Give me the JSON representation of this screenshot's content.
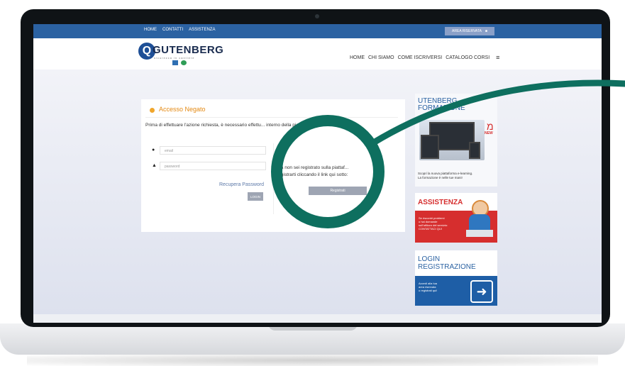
{
  "topbar": {
    "links": [
      "HOME",
      "CONTATTI",
      "ASSISTENZA"
    ],
    "area_riservata": "AREA RISERVATA"
  },
  "logo": {
    "mark": "Q",
    "name": "GUTENBERG",
    "tagline": "sicurezza in cantiere"
  },
  "main_nav": [
    "HOME",
    "CHI SIAMO",
    "COME ISCRIVERSI",
    "CATALOGO CORSI"
  ],
  "panel": {
    "title": "Accesso Negato",
    "message": "Prima di effettuare l'azione richiesta, è necessario effettu...                        interno della piatt...",
    "email_placeholder": "email",
    "password_placeholder": "password",
    "recupera": "Recupera Password",
    "login_label": "LOGIN",
    "reg_line1": "ora non sei registrato sulla piattaf...",
    "reg_line2": "registrarti cliccando il link qui sotto:",
    "registrati_label": "Registrati"
  },
  "ads": {
    "formazione": {
      "title_line1": "UTENBERG",
      "title_line2": "FORMAZIONE",
      "new": "NEW",
      "text_line1": "Scopri la nuova piattaforma e-learning.",
      "text_line2": "La formazione è nelle tue mani!"
    },
    "assistenza": {
      "title": "ASSISTENZA",
      "text_line1": "Se riscontri problemi",
      "text_line2": "o hai domande",
      "text_line3": "sull'utilizzo del servizio:",
      "text_line4": "CONTATTACI QUI"
    },
    "login": {
      "title_line1": "LOGIN",
      "title_line2": "REGISTRAZIONE",
      "text_line1": "Accedi alla tua",
      "text_line2": "area riservata",
      "text_line3": "o registrati qui!"
    }
  },
  "colors": {
    "brand_blue": "#2b62a2",
    "accent_orange": "#e48a14",
    "accent_red": "#d62e2e",
    "highlight_green": "#0e6f5f"
  },
  "icons": {
    "user": "user-icon",
    "lock": "lock-icon",
    "menu": "hamburger-icon",
    "warning": "warning-icon",
    "arrow": "arrow-right-icon"
  }
}
